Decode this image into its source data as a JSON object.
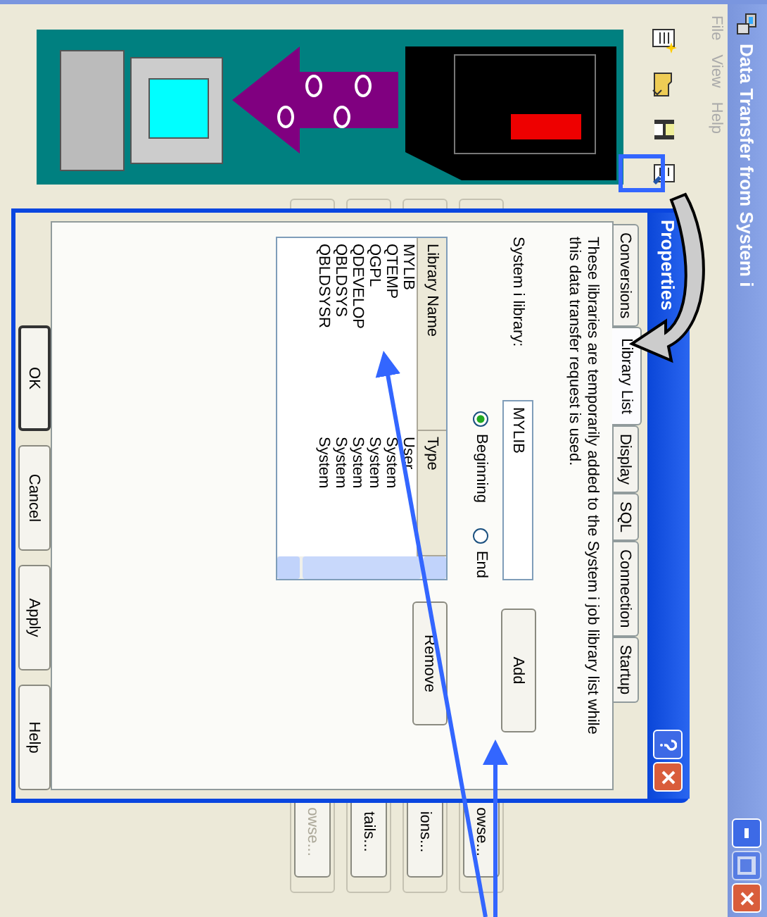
{
  "main_window": {
    "title": "Data Transfer from System i",
    "menu": [
      "File",
      "View",
      "Help"
    ],
    "side_buttons": [
      {
        "label": "owse...",
        "disabled": false
      },
      {
        "label": "ions...",
        "disabled": false
      },
      {
        "label": "tails...",
        "disabled": false
      },
      {
        "label": "owse...",
        "disabled": true
      }
    ]
  },
  "dialog": {
    "title": "Properties",
    "tabs": [
      {
        "label": "Conversions",
        "selected": false
      },
      {
        "label": "Library List",
        "selected": true
      },
      {
        "label": "Display",
        "selected": false
      },
      {
        "label": "SQL",
        "selected": false
      },
      {
        "label": "Connection",
        "selected": false
      },
      {
        "label": "Startup",
        "selected": false
      }
    ],
    "description": "These libraries are temporarily added to the System i job library list while this data transfer request is used.",
    "library_label": "System i library:",
    "library_value": "MYLIB",
    "add_button": "Add",
    "position_options": [
      {
        "label": "Beginning",
        "selected": true
      },
      {
        "label": "End",
        "selected": false
      }
    ],
    "list": {
      "columns": [
        "Library Name",
        "Type"
      ],
      "rows": [
        {
          "name": "MYLIB",
          "type": "User"
        },
        {
          "name": "QTEMP",
          "type": "System"
        },
        {
          "name": "QGPL",
          "type": "System"
        },
        {
          "name": "QDEVELOP",
          "type": "System"
        },
        {
          "name": "QBLDSYS",
          "type": "System"
        },
        {
          "name": "QBLDSYSR",
          "type": "System"
        }
      ]
    },
    "remove_button": "Remove",
    "buttons": [
      "OK",
      "Cancel",
      "Apply",
      "Help"
    ]
  }
}
